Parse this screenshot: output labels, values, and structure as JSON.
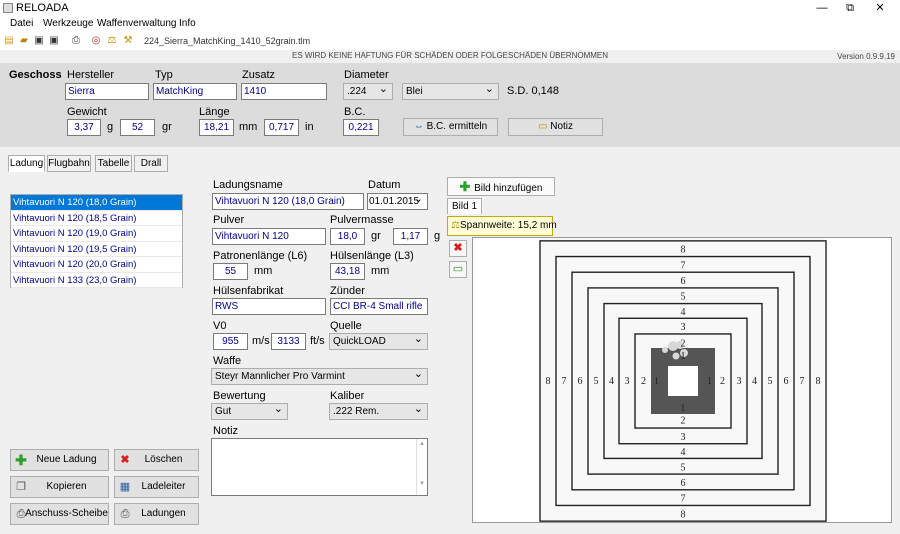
{
  "window": {
    "title": "RELOADA",
    "min": "—",
    "restore": "⧉",
    "close": "✕"
  },
  "menu": [
    "Datei",
    "Werkzeuge",
    "Waffenverwaltung",
    "Info"
  ],
  "toolbar": {
    "filename": "224_Sierra_MatchKing_1410_52grain.tlm"
  },
  "disclaimer": "ES WIRD KEINE HAFTUNG FÜR SCHÄDEN ODER FOLGESCHÄDEN ÜBERNOMMEN",
  "version": "Version 0.9.9.19",
  "geschoss": {
    "section": "Geschoss",
    "hersteller_label": "Hersteller",
    "hersteller": "Sierra",
    "typ_label": "Typ",
    "typ": "MatchKing",
    "zusatz_label": "Zusatz",
    "zusatz": "1410",
    "diameter_label": "Diameter",
    "diameter": ".224",
    "material": "Blei",
    "sd": "S.D. 0,148",
    "gewicht_label": "Gewicht",
    "gewicht_g": "3,37",
    "unit_g": "g",
    "gewicht_gr": "52",
    "unit_gr": "gr",
    "laenge_label": "Länge",
    "laenge_mm": "18,21",
    "unit_mm": "mm",
    "laenge_in": "0,717",
    "unit_in": "in",
    "bc_label": "B.C.",
    "bc": "0,221",
    "bc_button": "B.C. ermitteln",
    "notiz_button": "Notiz"
  },
  "tabs": [
    "Ladung",
    "Flugbahn",
    "Tabelle",
    "Drall"
  ],
  "loads": [
    "Vihtavuori N 120 (18,0 Grain)",
    "Vihtavuori N 120 (18,5 Grain)",
    "Vihtavuori N 120 (19,0 Grain)",
    "Vihtavuori N 120 (19,5 Grain)",
    "Vihtavuori N 120 (20,0 Grain)",
    "Vihtavuori N 133 (23,0 Grain)"
  ],
  "form": {
    "ladungsname_label": "Ladungsname",
    "ladungsname": "Vihtavuori N 120 (18,0 Grain)",
    "datum_label": "Datum",
    "datum": "01.01.2015",
    "pulver_label": "Pulver",
    "pulver": "Vihtavuori N 120",
    "pulvermasse_label": "Pulvermasse",
    "pulvermasse_gr": "18,0",
    "unit_gr": "gr",
    "pulvermasse_g": "1,17",
    "unit_g": "g",
    "patronenlaenge_label": "Patronenlänge (L6)",
    "patronenlaenge": "55",
    "unit_mm": "mm",
    "huelsenlaenge_label": "Hülsenlänge (L3)",
    "huelsenlaenge": "43,18",
    "unit_mm2": "mm",
    "huelsenfabrikat_label": "Hülsenfabrikat",
    "huelsenfabrikat": "RWS",
    "zuender_label": "Zünder",
    "zuender": "CCI BR-4 Small rifle",
    "v0_label": "V0",
    "v0_ms": "955",
    "unit_ms": "m/s",
    "v0_fts": "3133",
    "unit_fts": "ft/s",
    "quelle_label": "Quelle",
    "quelle": "QuickLOAD",
    "waffe_label": "Waffe",
    "waffe": "Steyr Mannlicher Pro Varmint",
    "bewertung_label": "Bewertung",
    "bewertung": "Gut",
    "kaliber_label": "Kaliber",
    "kaliber": ".222 Rem.",
    "notiz_label": "Notiz",
    "notiz": ""
  },
  "buttons": {
    "neu": "Neue Ladung",
    "loeschen": "Löschen",
    "kopieren": "Kopieren",
    "ladeleiter": "Ladeleiter",
    "anschuss": "Anschuss-Scheibe",
    "ladungen": "Ladungen"
  },
  "image": {
    "add_button": "Bild hinzufügen",
    "tab": "Bild 1",
    "spannweite": "Spannweite: 15,2 mm",
    "ring_labels": [
      "1",
      "2",
      "3",
      "4",
      "5",
      "6",
      "7",
      "8"
    ]
  },
  "colors": {
    "accent": "#0078d7",
    "value": "#00008b",
    "panel": "#dcdcdc"
  }
}
